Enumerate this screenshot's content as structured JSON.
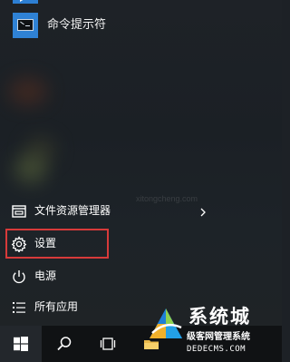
{
  "start_menu": {
    "top_partial_tile": "app-tile",
    "apps": [
      {
        "label": "命令提示符",
        "icon": "command-prompt-icon"
      }
    ],
    "items": [
      {
        "key": "explorer",
        "label": "文件资源管理器",
        "icon": "file-explorer-icon",
        "has_submenu": true
      },
      {
        "key": "settings",
        "label": "设置",
        "icon": "gear-icon",
        "highlighted": true
      },
      {
        "key": "power",
        "label": "电源",
        "icon": "power-icon"
      },
      {
        "key": "all_apps",
        "label": "所有应用",
        "icon": "list-icon"
      }
    ],
    "highlight_color": "#d73a3a"
  },
  "taskbar": {
    "buttons": [
      {
        "key": "start",
        "icon": "windows-logo-icon"
      },
      {
        "key": "search",
        "icon": "search-icon"
      },
      {
        "key": "task_view",
        "icon": "task-view-icon"
      },
      {
        "key": "file_explorer",
        "icon": "folder-icon"
      }
    ]
  },
  "watermark": {
    "brand": "系统城",
    "sub": "级客网管理系统",
    "site": "DEDECMS.COM",
    "faint_site": "xitongcheng.com"
  },
  "colors": {
    "tile_blue": "#2f82d5",
    "menu_bg": "#1d2126",
    "taskbar_bg": "#101214"
  }
}
